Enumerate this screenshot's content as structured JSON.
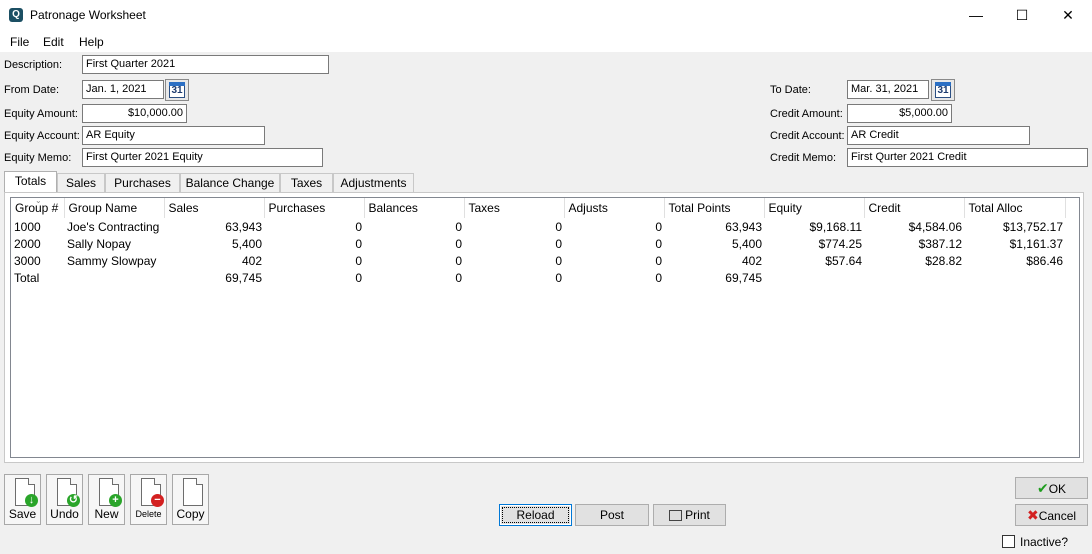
{
  "window": {
    "title": "Patronage Worksheet",
    "minimize": "—",
    "maximize": "☐",
    "close": "✕"
  },
  "menu": [
    "File",
    "Edit",
    "Help"
  ],
  "form": {
    "description_label": "Description:",
    "description_value": "First Quarter 2021",
    "from_date_label": "From Date:",
    "from_date_value": "Jan. 1, 2021",
    "to_date_label": "To Date:",
    "to_date_value": "Mar. 31, 2021",
    "calendar_glyph": "31",
    "equity_amount_label": "Equity Amount:",
    "equity_amount_value": "$10,000.00",
    "credit_amount_label": "Credit Amount:",
    "credit_amount_value": "$5,000.00",
    "equity_account_label": "Equity Account:",
    "equity_account_value": "AR Equity",
    "credit_account_label": "Credit Account:",
    "credit_account_value": "AR Credit",
    "equity_memo_label": "Equity Memo:",
    "equity_memo_value": "First Qurter 2021 Equity",
    "credit_memo_label": "Credit Memo:",
    "credit_memo_value": "First Qurter 2021 Credit"
  },
  "tabs": [
    "Totals",
    "Sales",
    "Purchases",
    "Balance Change",
    "Taxes",
    "Adjustments"
  ],
  "active_tab": "Totals",
  "table": {
    "columns": [
      "Group #",
      "Group Name",
      "Sales",
      "Purchases",
      "Balances",
      "Taxes",
      "Adjusts",
      "Total Points",
      "Equity",
      "Credit",
      "Total Alloc"
    ],
    "rows": [
      [
        "1000",
        "Joe's Contracting",
        "63,943",
        "0",
        "0",
        "0",
        "0",
        "63,943",
        "$9,168.11",
        "$4,584.06",
        "$13,752.17"
      ],
      [
        "2000",
        "Sally Nopay",
        "5,400",
        "0",
        "0",
        "0",
        "0",
        "5,400",
        "$774.25",
        "$387.12",
        "$1,161.37"
      ],
      [
        "3000",
        "Sammy Slowpay",
        "402",
        "0",
        "0",
        "0",
        "0",
        "402",
        "$57.64",
        "$28.82",
        "$86.46"
      ],
      [
        "Total",
        "",
        "69,745",
        "0",
        "0",
        "0",
        "0",
        "69,745",
        "",
        "",
        ""
      ]
    ]
  },
  "toolbar": {
    "save": "Save",
    "undo": "Undo",
    "new": "New",
    "delete": "Delete",
    "copy": "Copy"
  },
  "actions": {
    "reload": "Reload",
    "post": "Post",
    "print": "Print",
    "ok": "OK",
    "cancel": "Cancel",
    "inactive": "Inactive?"
  },
  "colors": {
    "save_badge": "#2aa52a",
    "undo_badge": "#2aa52a",
    "new_badge": "#2aa52a",
    "delete_badge": "#d32020",
    "ok_check": "#1f9d1f",
    "cancel_x": "#d32020"
  }
}
